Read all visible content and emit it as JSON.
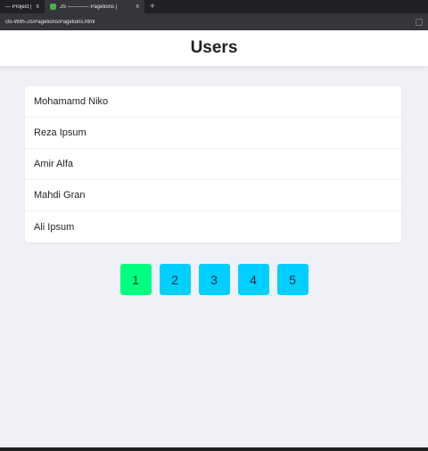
{
  "browser": {
    "tabs": [
      {
        "title": "--- Project |",
        "close": "x"
      },
      {
        "title": "JS ------------ Pagetions |",
        "close": "x"
      }
    ],
    "new_tab": "+",
    "url": "cts-With-JS/Pagetions/Pagetions.html"
  },
  "header": {
    "title": "Users"
  },
  "users": [
    {
      "name": "Mohamamd Niko"
    },
    {
      "name": "Reza Ipsum"
    },
    {
      "name": "Amir Alfa"
    },
    {
      "name": "Mahdi Gran"
    },
    {
      "name": "Ali Ipsum"
    }
  ],
  "pagination": {
    "pages": [
      "1",
      "2",
      "3",
      "4",
      "5"
    ],
    "active_page": "1",
    "active_color": "#00ff7f",
    "inactive_color": "#00cfff"
  }
}
